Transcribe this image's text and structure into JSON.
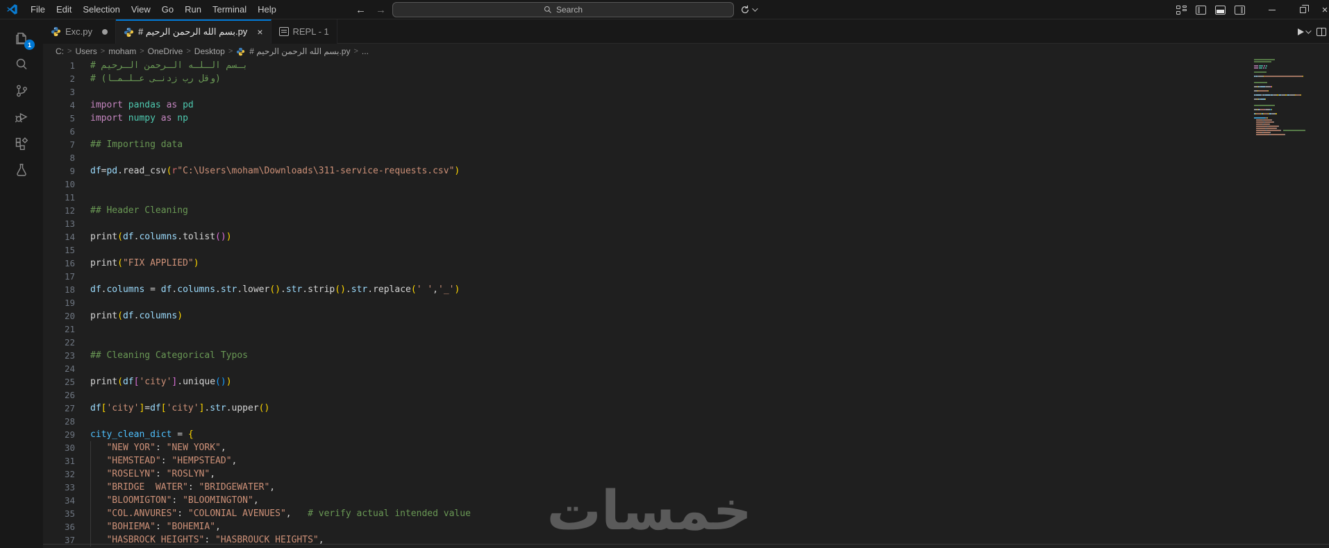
{
  "colors": {
    "accent": "#0078d4",
    "titlebar_bg": "#181818",
    "editor_bg": "#1f1f1f",
    "comment": "#6A9955",
    "keyword": "#C586C0",
    "module": "#4EC9B0",
    "variable": "#9CDCFE",
    "variable_bright": "#4FC1FF",
    "function": "#d6d6d6",
    "string": "#CE9178",
    "bracket_gold": "#FFD700",
    "bracket_pink": "#DA70D6",
    "bracket_blue": "#179FFF",
    "line_number": "#6e7681",
    "badge_bg": "#0078d4"
  },
  "title_bar": {
    "menus": [
      "File",
      "Edit",
      "Selection",
      "View",
      "Go",
      "Run",
      "Terminal",
      "Help"
    ],
    "search_label": "Search",
    "back_arrow": "←",
    "forward_arrow": "→",
    "close_glyph": "×"
  },
  "activity_bar": {
    "explorer_badge": "1",
    "items": [
      "explorer",
      "search",
      "source-control",
      "run-and-debug",
      "extensions",
      "testing"
    ]
  },
  "tabs": [
    {
      "label": "Exc.py",
      "modified": true,
      "active": false
    },
    {
      "label": "# بسم الله الرحمن الرحيم.py",
      "modified": false,
      "active": true,
      "close_glyph": "×"
    },
    {
      "label": "REPL - 1",
      "modified": false,
      "active": false
    }
  ],
  "breadcrumb": {
    "items": [
      "C:",
      "Users",
      "moham",
      "OneDrive",
      "Desktop",
      "# بسم الله الرحمن الرحيم.py",
      "..."
    ],
    "separator": ">",
    "file_item_index": 5
  },
  "editor": {
    "lines": [
      {
        "n": 1,
        "tokens": [
          [
            "# بـسم الـلـه الـرحمن الـرحيم",
            "comment"
          ]
        ]
      },
      {
        "n": 2,
        "tokens": [
          [
            "# (وقل رب زدنـى عـلـمـا)",
            "comment"
          ]
        ]
      },
      {
        "n": 3,
        "tokens": []
      },
      {
        "n": 4,
        "tokens": [
          [
            "import",
            "kw"
          ],
          [
            " ",
            "pn"
          ],
          [
            "pandas",
            "md"
          ],
          [
            " ",
            "pn"
          ],
          [
            "as",
            "kw"
          ],
          [
            " ",
            "pn"
          ],
          [
            "pd",
            "md"
          ]
        ]
      },
      {
        "n": 5,
        "tokens": [
          [
            "import",
            "kw"
          ],
          [
            " ",
            "pn"
          ],
          [
            "numpy",
            "md"
          ],
          [
            " ",
            "pn"
          ],
          [
            "as",
            "kw"
          ],
          [
            " ",
            "pn"
          ],
          [
            "np",
            "md"
          ]
        ]
      },
      {
        "n": 6,
        "tokens": []
      },
      {
        "n": 7,
        "tokens": [
          [
            "## Importing data",
            "comment"
          ]
        ]
      },
      {
        "n": 8,
        "tokens": []
      },
      {
        "n": 9,
        "tokens": [
          [
            "df",
            "vr"
          ],
          [
            "=",
            "pn"
          ],
          [
            "pd",
            "vr"
          ],
          [
            ".",
            "pn"
          ],
          [
            "read_csv",
            "fn"
          ],
          [
            "(",
            "b1"
          ],
          [
            "r",
            "sp"
          ],
          [
            "\"C:\\Users\\moham\\Downloads\\311-service-requests.csv\"",
            "st"
          ],
          [
            ")",
            "b1"
          ]
        ]
      },
      {
        "n": 10,
        "tokens": []
      },
      {
        "n": 11,
        "tokens": []
      },
      {
        "n": 12,
        "tokens": [
          [
            "## Header Cleaning",
            "comment"
          ]
        ]
      },
      {
        "n": 13,
        "tokens": []
      },
      {
        "n": 14,
        "tokens": [
          [
            "print",
            "fn"
          ],
          [
            "(",
            "b1"
          ],
          [
            "df",
            "vr"
          ],
          [
            ".",
            "pn"
          ],
          [
            "columns",
            "vr"
          ],
          [
            ".",
            "pn"
          ],
          [
            "tolist",
            "fn"
          ],
          [
            "(",
            "b2"
          ],
          [
            ")",
            "b2"
          ],
          [
            ")",
            "b1"
          ]
        ]
      },
      {
        "n": 15,
        "tokens": []
      },
      {
        "n": 16,
        "tokens": [
          [
            "print",
            "fn"
          ],
          [
            "(",
            "b1"
          ],
          [
            "\"FIX APPLIED\"",
            "st"
          ],
          [
            ")",
            "b1"
          ]
        ]
      },
      {
        "n": 17,
        "tokens": []
      },
      {
        "n": 18,
        "tokens": [
          [
            "df",
            "vr"
          ],
          [
            ".",
            "pn"
          ],
          [
            "columns",
            "vr"
          ],
          [
            " = ",
            "pn"
          ],
          [
            "df",
            "vr"
          ],
          [
            ".",
            "pn"
          ],
          [
            "columns",
            "vr"
          ],
          [
            ".",
            "pn"
          ],
          [
            "str",
            "vr"
          ],
          [
            ".",
            "pn"
          ],
          [
            "lower",
            "fn"
          ],
          [
            "(",
            "b1"
          ],
          [
            ")",
            "b1"
          ],
          [
            ".",
            "pn"
          ],
          [
            "str",
            "vr"
          ],
          [
            ".",
            "pn"
          ],
          [
            "strip",
            "fn"
          ],
          [
            "(",
            "b1"
          ],
          [
            ")",
            "b1"
          ],
          [
            ".",
            "pn"
          ],
          [
            "str",
            "vr"
          ],
          [
            ".",
            "pn"
          ],
          [
            "replace",
            "fn"
          ],
          [
            "(",
            "b1"
          ],
          [
            "' '",
            "st"
          ],
          [
            ",",
            "pn"
          ],
          [
            "'_'",
            "st"
          ],
          [
            ")",
            "b1"
          ]
        ]
      },
      {
        "n": 19,
        "tokens": []
      },
      {
        "n": 20,
        "tokens": [
          [
            "print",
            "fn"
          ],
          [
            "(",
            "b1"
          ],
          [
            "df",
            "vr"
          ],
          [
            ".",
            "pn"
          ],
          [
            "columns",
            "vr"
          ],
          [
            ")",
            "b1"
          ]
        ]
      },
      {
        "n": 21,
        "tokens": []
      },
      {
        "n": 22,
        "tokens": []
      },
      {
        "n": 23,
        "tokens": [
          [
            "## Cleaning Categorical Typos",
            "comment"
          ]
        ]
      },
      {
        "n": 24,
        "tokens": []
      },
      {
        "n": 25,
        "tokens": [
          [
            "print",
            "fn"
          ],
          [
            "(",
            "b1"
          ],
          [
            "df",
            "vr"
          ],
          [
            "[",
            "b2"
          ],
          [
            "'city'",
            "st"
          ],
          [
            "]",
            "b2"
          ],
          [
            ".",
            "pn"
          ],
          [
            "unique",
            "fn"
          ],
          [
            "(",
            "b3"
          ],
          [
            ")",
            "b3"
          ],
          [
            ")",
            "b1"
          ]
        ]
      },
      {
        "n": 26,
        "tokens": []
      },
      {
        "n": 27,
        "tokens": [
          [
            "df",
            "vr"
          ],
          [
            "[",
            "b1"
          ],
          [
            "'city'",
            "st"
          ],
          [
            "]",
            "b1"
          ],
          [
            "=",
            "pn"
          ],
          [
            "df",
            "vr"
          ],
          [
            "[",
            "b1"
          ],
          [
            "'city'",
            "st"
          ],
          [
            "]",
            "b1"
          ],
          [
            ".",
            "pn"
          ],
          [
            "str",
            "vr"
          ],
          [
            ".",
            "pn"
          ],
          [
            "upper",
            "fn"
          ],
          [
            "(",
            "b1"
          ],
          [
            ")",
            "b1"
          ]
        ]
      },
      {
        "n": 28,
        "tokens": []
      },
      {
        "n": 29,
        "tokens": [
          [
            "city_clean_dict",
            "vb"
          ],
          [
            " = ",
            "pn"
          ],
          [
            "{",
            "b1"
          ]
        ]
      },
      {
        "n": 30,
        "guided": true,
        "tokens": [
          [
            "   ",
            "pn"
          ],
          [
            "\"NEW YOR\"",
            "st"
          ],
          [
            ": ",
            "pn"
          ],
          [
            "\"NEW YORK\"",
            "st"
          ],
          [
            ",",
            "pn"
          ]
        ]
      },
      {
        "n": 31,
        "guided": true,
        "tokens": [
          [
            "   ",
            "pn"
          ],
          [
            "\"HEMSTEAD\"",
            "st"
          ],
          [
            ": ",
            "pn"
          ],
          [
            "\"HEMPSTEAD\"",
            "st"
          ],
          [
            ",",
            "pn"
          ]
        ]
      },
      {
        "n": 32,
        "guided": true,
        "tokens": [
          [
            "   ",
            "pn"
          ],
          [
            "\"ROSELYN\"",
            "st"
          ],
          [
            ": ",
            "pn"
          ],
          [
            "\"ROSLYN\"",
            "st"
          ],
          [
            ",",
            "pn"
          ]
        ]
      },
      {
        "n": 33,
        "guided": true,
        "tokens": [
          [
            "   ",
            "pn"
          ],
          [
            "\"BRIDGE  WATER\"",
            "st"
          ],
          [
            ": ",
            "pn"
          ],
          [
            "\"BRIDGEWATER\"",
            "st"
          ],
          [
            ",",
            "pn"
          ]
        ]
      },
      {
        "n": 34,
        "guided": true,
        "tokens": [
          [
            "   ",
            "pn"
          ],
          [
            "\"BLOOMIGTON\"",
            "st"
          ],
          [
            ": ",
            "pn"
          ],
          [
            "\"BLOOMINGTON\"",
            "st"
          ],
          [
            ",",
            "pn"
          ]
        ]
      },
      {
        "n": 35,
        "guided": true,
        "tokens": [
          [
            "   ",
            "pn"
          ],
          [
            "\"COL.ANVURES\"",
            "st"
          ],
          [
            ": ",
            "pn"
          ],
          [
            "\"COLONIAL AVENUES\"",
            "st"
          ],
          [
            ",",
            "pn"
          ],
          [
            "   ",
            "pn"
          ],
          [
            "# verify actual intended value",
            "comment"
          ]
        ]
      },
      {
        "n": 36,
        "guided": true,
        "tokens": [
          [
            "   ",
            "pn"
          ],
          [
            "\"BOHIEMA\"",
            "st"
          ],
          [
            ": ",
            "pn"
          ],
          [
            "\"BOHEMIA\"",
            "st"
          ],
          [
            ",",
            "pn"
          ]
        ]
      },
      {
        "n": 37,
        "guided": true,
        "tokens": [
          [
            "   ",
            "pn"
          ],
          [
            "\"HASBROCK HEIGHTS\"",
            "st"
          ],
          [
            ": ",
            "pn"
          ],
          [
            "\"HASBROUCK HEIGHTS\"",
            "st"
          ],
          [
            ",",
            "pn"
          ]
        ]
      }
    ]
  },
  "watermark": {
    "text": "خمسات"
  }
}
